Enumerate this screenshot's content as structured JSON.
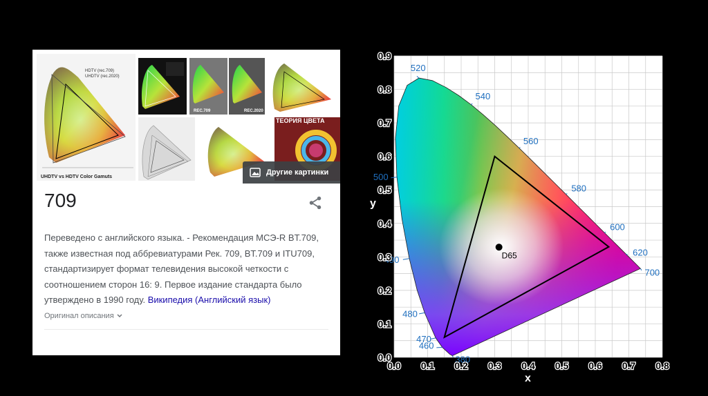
{
  "card": {
    "thumb_caption_1": "UHDTV vs HDTV Color Gamuts",
    "legend_hdtv": "HDTV (rec.709)",
    "legend_uhdtv": "UHDTV (rec.2020)",
    "cap_rec709": "REC.709",
    "cap_rec2020": "REC.2020",
    "theory_label": "ТЕОРИЯ ЦВЕТА",
    "more_images": "Другие картинки",
    "title": "709",
    "description": "Переведено с английского языка. - Рекомендация МСЭ-R BT.709, также известная под аббревиатурами Рек. 709, BT.709 и ITU709, стандартизирует формат телевидения высокой четкости с соотношением сторон 16: 9. Первое издание стандарта было утверждено в 1990 году.",
    "source_link": "Википедия (Английский язык)",
    "original_toggle": "Оригинал описания"
  },
  "diagram": {
    "x_axis_label": "x",
    "y_axis_label": "y",
    "x_ticks": [
      "0.0",
      "0.1",
      "0.2",
      "0.3",
      "0.4",
      "0.5",
      "0.6",
      "0.7",
      "0.8"
    ],
    "y_ticks": [
      "0.0",
      "0.1",
      "0.2",
      "0.3",
      "0.4",
      "0.5",
      "0.6",
      "0.7",
      "0.8",
      "0.9"
    ],
    "white_point": {
      "label": "D65",
      "x": 0.3127,
      "y": 0.329
    },
    "gamut_triangle": [
      [
        0.64,
        0.33
      ],
      [
        0.3,
        0.6
      ],
      [
        0.15,
        0.06
      ]
    ],
    "wavelength_labels": [
      {
        "nm": "380",
        "x": 0.174,
        "y": 0.005
      },
      {
        "nm": "460",
        "x": 0.144,
        "y": 0.03
      },
      {
        "nm": "470",
        "x": 0.124,
        "y": 0.058
      },
      {
        "nm": "480",
        "x": 0.091,
        "y": 0.133
      },
      {
        "nm": "490",
        "x": 0.045,
        "y": 0.295
      },
      {
        "nm": "500",
        "x": 0.008,
        "y": 0.538
      },
      {
        "nm": "520",
        "x": 0.074,
        "y": 0.834
      },
      {
        "nm": "540",
        "x": 0.23,
        "y": 0.754
      },
      {
        "nm": "560",
        "x": 0.373,
        "y": 0.624
      },
      {
        "nm": "580",
        "x": 0.512,
        "y": 0.487
      },
      {
        "nm": "600",
        "x": 0.627,
        "y": 0.372
      },
      {
        "nm": "620",
        "x": 0.691,
        "y": 0.308
      },
      {
        "nm": "700",
        "x": 0.735,
        "y": 0.265
      }
    ],
    "locus": [
      [
        0.1741,
        0.005
      ],
      [
        0.1666,
        0.0089
      ],
      [
        0.144,
        0.0297
      ],
      [
        0.1241,
        0.0578
      ],
      [
        0.0913,
        0.1327
      ],
      [
        0.0687,
        0.2007
      ],
      [
        0.0454,
        0.295
      ],
      [
        0.0235,
        0.4127
      ],
      [
        0.0082,
        0.5384
      ],
      [
        0.0039,
        0.6548
      ],
      [
        0.0139,
        0.7502
      ],
      [
        0.0389,
        0.812
      ],
      [
        0.0743,
        0.8338
      ],
      [
        0.1142,
        0.8262
      ],
      [
        0.1547,
        0.8059
      ],
      [
        0.1929,
        0.7816
      ],
      [
        0.2296,
        0.7543
      ],
      [
        0.2658,
        0.7243
      ],
      [
        0.3016,
        0.6923
      ],
      [
        0.3373,
        0.6589
      ],
      [
        0.3731,
        0.6245
      ],
      [
        0.4087,
        0.5896
      ],
      [
        0.4441,
        0.5547
      ],
      [
        0.4788,
        0.5202
      ],
      [
        0.5125,
        0.4866
      ],
      [
        0.5448,
        0.4544
      ],
      [
        0.5752,
        0.4242
      ],
      [
        0.6029,
        0.3965
      ],
      [
        0.627,
        0.3725
      ],
      [
        0.6482,
        0.3514
      ],
      [
        0.6658,
        0.334
      ],
      [
        0.6915,
        0.3083
      ],
      [
        0.7079,
        0.292
      ],
      [
        0.7347,
        0.2653
      ]
    ]
  },
  "colors": {
    "link": "#1a0dab",
    "label_blue": "#1f6fbf",
    "background": "#000000"
  }
}
